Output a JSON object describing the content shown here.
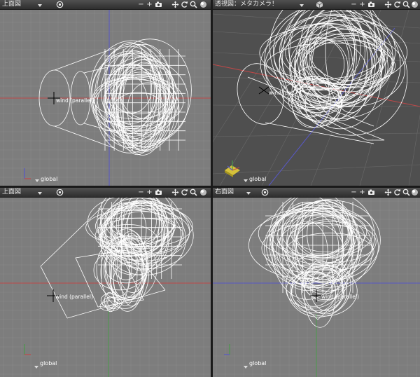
{
  "viewports": {
    "top_left": {
      "title": "上面図",
      "light_label": "global",
      "wind_label": "wind (parallel)"
    },
    "top_right": {
      "title": "透視図：メタカメラ！",
      "light_label": "global",
      "wind_label": "wind (pa"
    },
    "bottom_left": {
      "title": "上面図",
      "light_label": "global",
      "wind_label": "wind (parallel)"
    },
    "bottom_right": {
      "title": "右面図",
      "light_label": "global",
      "wind_label": "wind (parallel)"
    }
  },
  "toolbar_icons": [
    "menu-arrow-icon",
    "target-icon",
    "minus-icon",
    "plus-icon",
    "camera-icon",
    "move-icon",
    "rotate-icon",
    "zoom-icon",
    "shading-icon"
  ],
  "toolbar_glyphs": {
    "minus": "−",
    "plus": "+"
  },
  "colors": {
    "viewport_bg": "#7d7d7d",
    "perspective_bg": "#4f4f4f",
    "grid_line": "#8c8c8c",
    "axis_x": "#c04848",
    "axis_y": "#4a9a4a",
    "axis_z": "#5858c8",
    "wireframe": "#ffffff",
    "divider": "#1a1a1a"
  }
}
